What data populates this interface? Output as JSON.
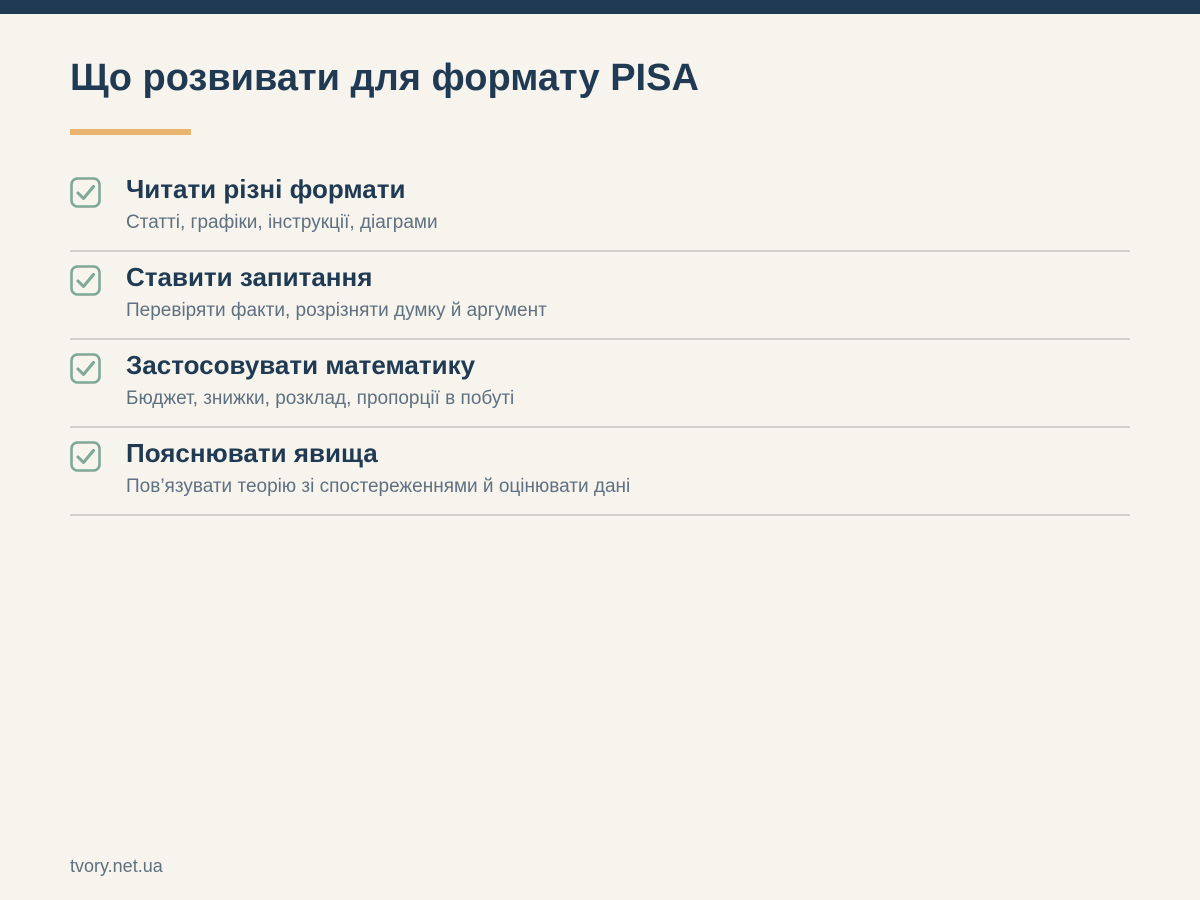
{
  "header": {
    "title": "Що розвивати для формату PISA"
  },
  "checklist": {
    "items": [
      {
        "title": "Читати різні формати",
        "description": "Статті, графіки, інструкції, діаграми",
        "icon": "checkbox-checked-icon"
      },
      {
        "title": "Ставити запитання",
        "description": "Перевіряти факти, розрізняти думку й аргумент",
        "icon": "checkbox-checked-icon"
      },
      {
        "title": "Застосовувати математику",
        "description": "Бюджет, знижки, розклад, пропорції в побуті",
        "icon": "checkbox-checked-icon"
      },
      {
        "title": "Пояснювати явища",
        "description": "Пов’язувати теорію зі спостереженнями й оцінювати дані",
        "icon": "checkbox-checked-icon"
      }
    ]
  },
  "footer": {
    "site": "tvory.net.ua"
  },
  "colors": {
    "background": "#f7f4ee",
    "navy": "#1f3a52",
    "accent": "#e8b46e",
    "check_green": "#7fa896",
    "divider": "#d3d0cb",
    "muted_text": "#5f7080"
  }
}
